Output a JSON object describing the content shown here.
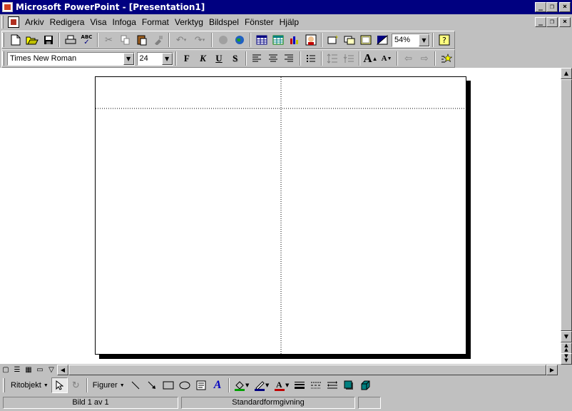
{
  "window": {
    "title": "Microsoft PowerPoint - [Presentation1]",
    "min_glyph": "_",
    "restore_glyph": "❐",
    "close_glyph": "×"
  },
  "menubar": {
    "items": [
      "Arkiv",
      "Redigera",
      "Visa",
      "Infoga",
      "Format",
      "Verktyg",
      "Bildspel",
      "Fönster",
      "Hjälp"
    ]
  },
  "standard_toolbar": {
    "zoom": "54%",
    "spellcheck_label": "ABC",
    "icons": [
      "new-icon",
      "open-icon",
      "save-icon",
      "print-icon",
      "spelling-icon",
      "cut-icon",
      "copy-icon",
      "paste-icon",
      "format-painter-icon",
      "undo-icon",
      "redo-icon",
      "hyperlink-icon",
      "web-toolbar-icon",
      "insert-word-table-icon",
      "insert-excel-worksheet-icon",
      "insert-chart-icon",
      "insert-clipart-icon",
      "new-slide-icon",
      "slide-layout-icon",
      "apply-design-icon",
      "black-white-view-icon",
      "help-icon"
    ]
  },
  "formatting_toolbar": {
    "font_name": "Times New Roman",
    "font_size": "24",
    "bold": "F",
    "italic": "K",
    "underline": "U",
    "shadow": "S",
    "icons": [
      "align-left-icon",
      "center-icon",
      "align-right-icon",
      "bullets-icon",
      "increase-spacing-icon",
      "decrease-spacing-icon",
      "increase-font-size-icon",
      "decrease-font-size-icon",
      "promote-icon",
      "demote-icon",
      "animation-effects-icon"
    ]
  },
  "drawing_toolbar": {
    "draw_menu": "Ritobjekt",
    "autoshapes_menu": "Figurer"
  },
  "statusbar": {
    "slide_position": "Bild 1 av 1",
    "design_template": "Standardformgivning"
  }
}
